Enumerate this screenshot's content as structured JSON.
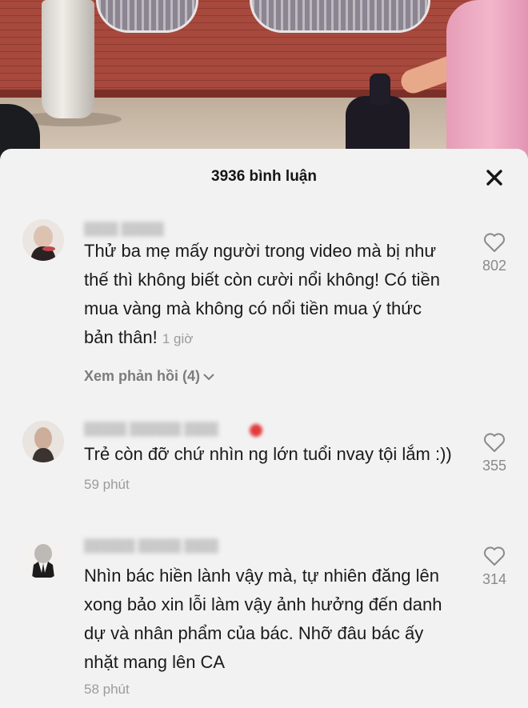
{
  "sheet": {
    "title": "3936 bình luận",
    "close_icon": "close-icon"
  },
  "comments": [
    {
      "text": "Thử ba mẹ mấy người trong video mà bị như thế thì không biết còn cười nổi không! Có tiền mua vàng mà không có nổi tiền mua ý thức bản thân!",
      "time": "1 giờ",
      "likes": "802",
      "replies_label": "Xem phản hồi (4)",
      "avatar_icon": "avatar"
    },
    {
      "text": "Trẻ còn đỡ chứ nhìn ng lớn tuổi nvay tội lắm :))",
      "time": "59 phút",
      "likes": "355",
      "avatar_icon": "avatar"
    },
    {
      "text": "Nhìn bác hiền lành vậy mà, tự nhiên đăng lên xong bảo xin lỗi làm vậy ảnh hưởng đến danh dự và nhân phẩm của bác. Nhỡ đâu bác ấy nhặt mang lên CA",
      "time": "58 phút",
      "likes": "314",
      "avatar_icon": "avatar"
    }
  ],
  "icons": {
    "like": "heart-outline-icon",
    "expand": "chevron-down-icon"
  }
}
